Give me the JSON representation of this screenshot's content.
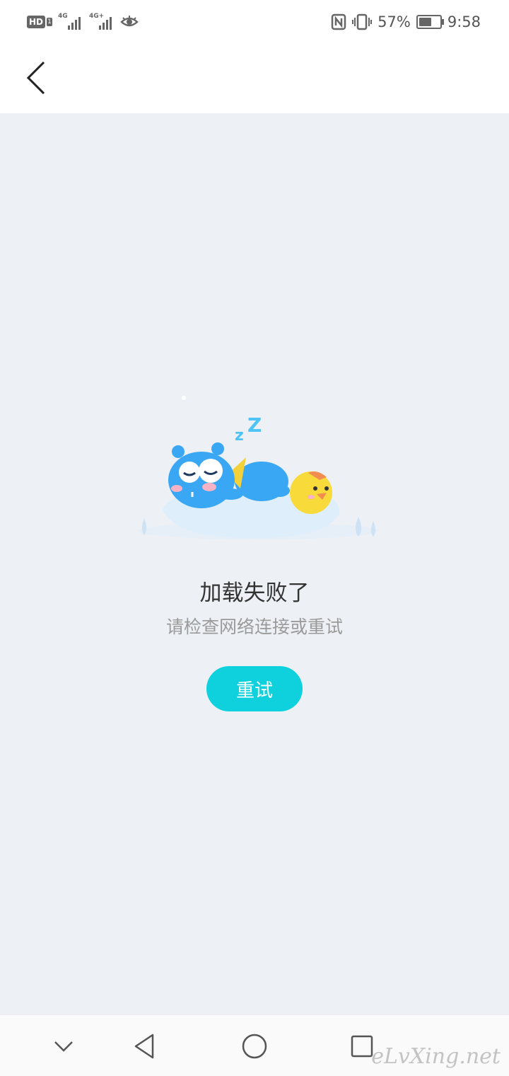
{
  "status_bar": {
    "hd_label": "HD",
    "sim1_label": "1",
    "net1_label": "4G",
    "net2_label": "4G+",
    "battery_percent": "57%",
    "time": "9:58",
    "icons": [
      "hd-icon",
      "signal-icon",
      "signal-icon",
      "eye-icon",
      "nfc-icon",
      "vibrate-icon",
      "battery-icon"
    ]
  },
  "header": {
    "back_icon": "chevron-left-icon"
  },
  "error": {
    "title": "加载失败了",
    "subtitle": "请检查网络连接或重试",
    "retry_label": "重试"
  },
  "colors": {
    "accent": "#0fd1de",
    "background": "#edf1f5"
  },
  "nav_bar": {
    "icons": [
      "chevron-down-icon",
      "back-triangle-icon",
      "home-circle-icon",
      "recents-square-icon"
    ]
  },
  "watermark": "eLvXing.net"
}
